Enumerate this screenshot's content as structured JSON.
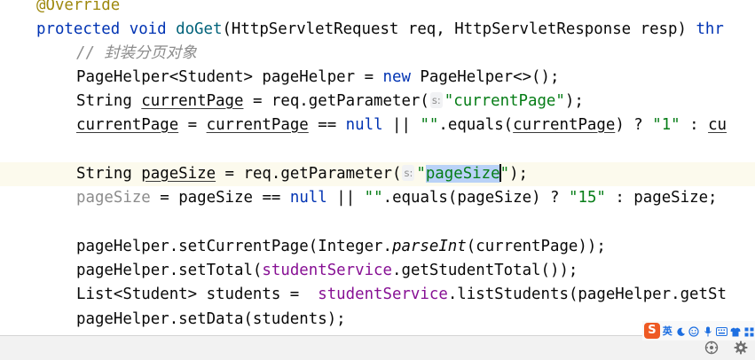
{
  "editor": {
    "lines": {
      "l1": {
        "annotation": "@Override"
      },
      "l2": {
        "kw_protected": "protected",
        "kw_void": "void",
        "method": "doGet",
        "params": "(HttpServletRequest req, HttpServletResponse resp) ",
        "kw_throws": "thr"
      },
      "l3": {
        "comment": "// 封装分页对象"
      },
      "l4": {
        "a": "PageHelper<Student> pageHelper = ",
        "kw_new": "new",
        "b": " PageHelper<>();"
      },
      "l5": {
        "a": "String ",
        "var": "currentPage",
        "b": " = req.getParameter(",
        "hint": "s:",
        "str": "\"currentPage\"",
        "c": ");"
      },
      "l6": {
        "v1": "currentPage",
        "a": " = ",
        "v2": "currentPage",
        "b": " == ",
        "kw_null": "null",
        "c": " || ",
        "str_empty": "\"\"",
        "d": ".equals(",
        "v3": "currentPage",
        "e": ") ? ",
        "str_1": "\"1\"",
        "f": " : ",
        "v4": "cu"
      },
      "l8": {
        "a": "String ",
        "var": "pageSize",
        "b": " = req.getParameter(",
        "hint": "s:",
        "q1": "\"",
        "sel": "pageSize",
        "q2": "\"",
        "c": ");"
      },
      "l9": {
        "v1": "pageSize",
        "a": " = ",
        "v2a": "pag",
        "v2b": "eSize",
        "b": " == ",
        "kw_null": "null",
        "c": " || ",
        "str_empty": "\"\"",
        "d": ".equals(pageSize) ? ",
        "str_15": "\"15\"",
        "e": " : pageSize;"
      },
      "l11": {
        "a": "pageHelper.setCurrentPage(Integer.",
        "ital": "parseInt",
        "b": "(currentPage));"
      },
      "l12": {
        "a": "pageHelper.setTotal(",
        "fld": "studentService",
        "b": ".getStudentTotal());"
      },
      "l13": {
        "a": "List<Student> students =  ",
        "fld": "studentService",
        "b": ".listStudents(pageHelper.getSt"
      },
      "l14": {
        "a": "pageHelper.setData(students);"
      }
    }
  },
  "ime_toolbar": {
    "logo": "S",
    "lang": "英",
    "icons": [
      "moon-icon",
      "smiley-icon",
      "microphone-icon",
      "keyboard-icon",
      "shirt-icon",
      "grid-icon"
    ]
  },
  "status_bar": {
    "icons": [
      "gamepad-icon",
      "settings-gear-icon"
    ]
  },
  "colors": {
    "keyword": "#0033b3",
    "annotation": "#9e880d",
    "method": "#00627a",
    "string": "#067d17",
    "field": "#871094",
    "comment": "#8c8c8c",
    "selection": "#b9d2f7",
    "current_line": "#fcfaed",
    "ime_logo": "#ee5a24",
    "ime_accent": "#1e6fe1"
  }
}
